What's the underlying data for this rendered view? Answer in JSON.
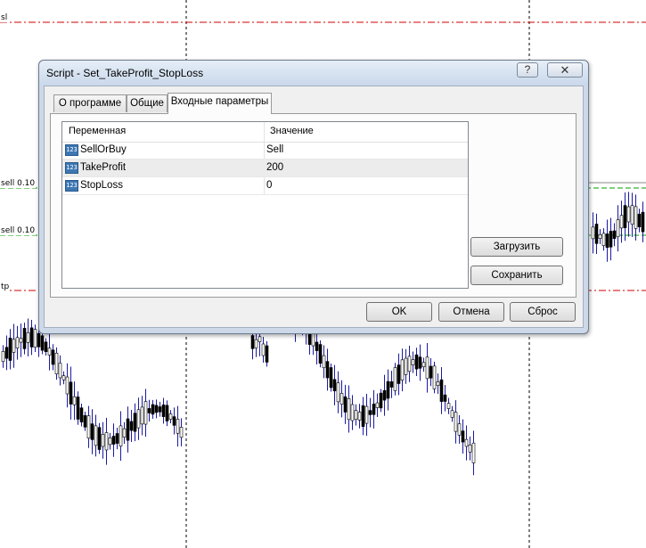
{
  "chart": {
    "labels": {
      "sl": "sl",
      "sell1": "sell 0.10",
      "sell2": "sell 0.10",
      "tp": "tp"
    },
    "colors": {
      "up_candle": "#ffffff",
      "down_candle": "#000000",
      "wick": "#1a1aa0",
      "level_red": "#d00000",
      "level_green": "#00a000",
      "grid": "#000000"
    }
  },
  "dialog": {
    "title": "Script - Set_TakeProfit_StopLoss",
    "help_icon": "?",
    "close_icon": "✕",
    "tabs": [
      "О программе",
      "Общие",
      "Входные параметры"
    ],
    "active_tab": "Входные параметры",
    "grid": {
      "headers": {
        "variable": "Переменная",
        "value": "Значение"
      },
      "type_icon": "123",
      "rows": [
        {
          "name": "SellOrBuy",
          "value": "Sell"
        },
        {
          "name": "TakeProfit",
          "value": "200"
        },
        {
          "name": "StopLoss",
          "value": "0"
        }
      ]
    },
    "buttons": {
      "load": "Загрузить",
      "save": "Сохранить",
      "ok": "OK",
      "cancel": "Отмена",
      "reset": "Сброс"
    }
  }
}
